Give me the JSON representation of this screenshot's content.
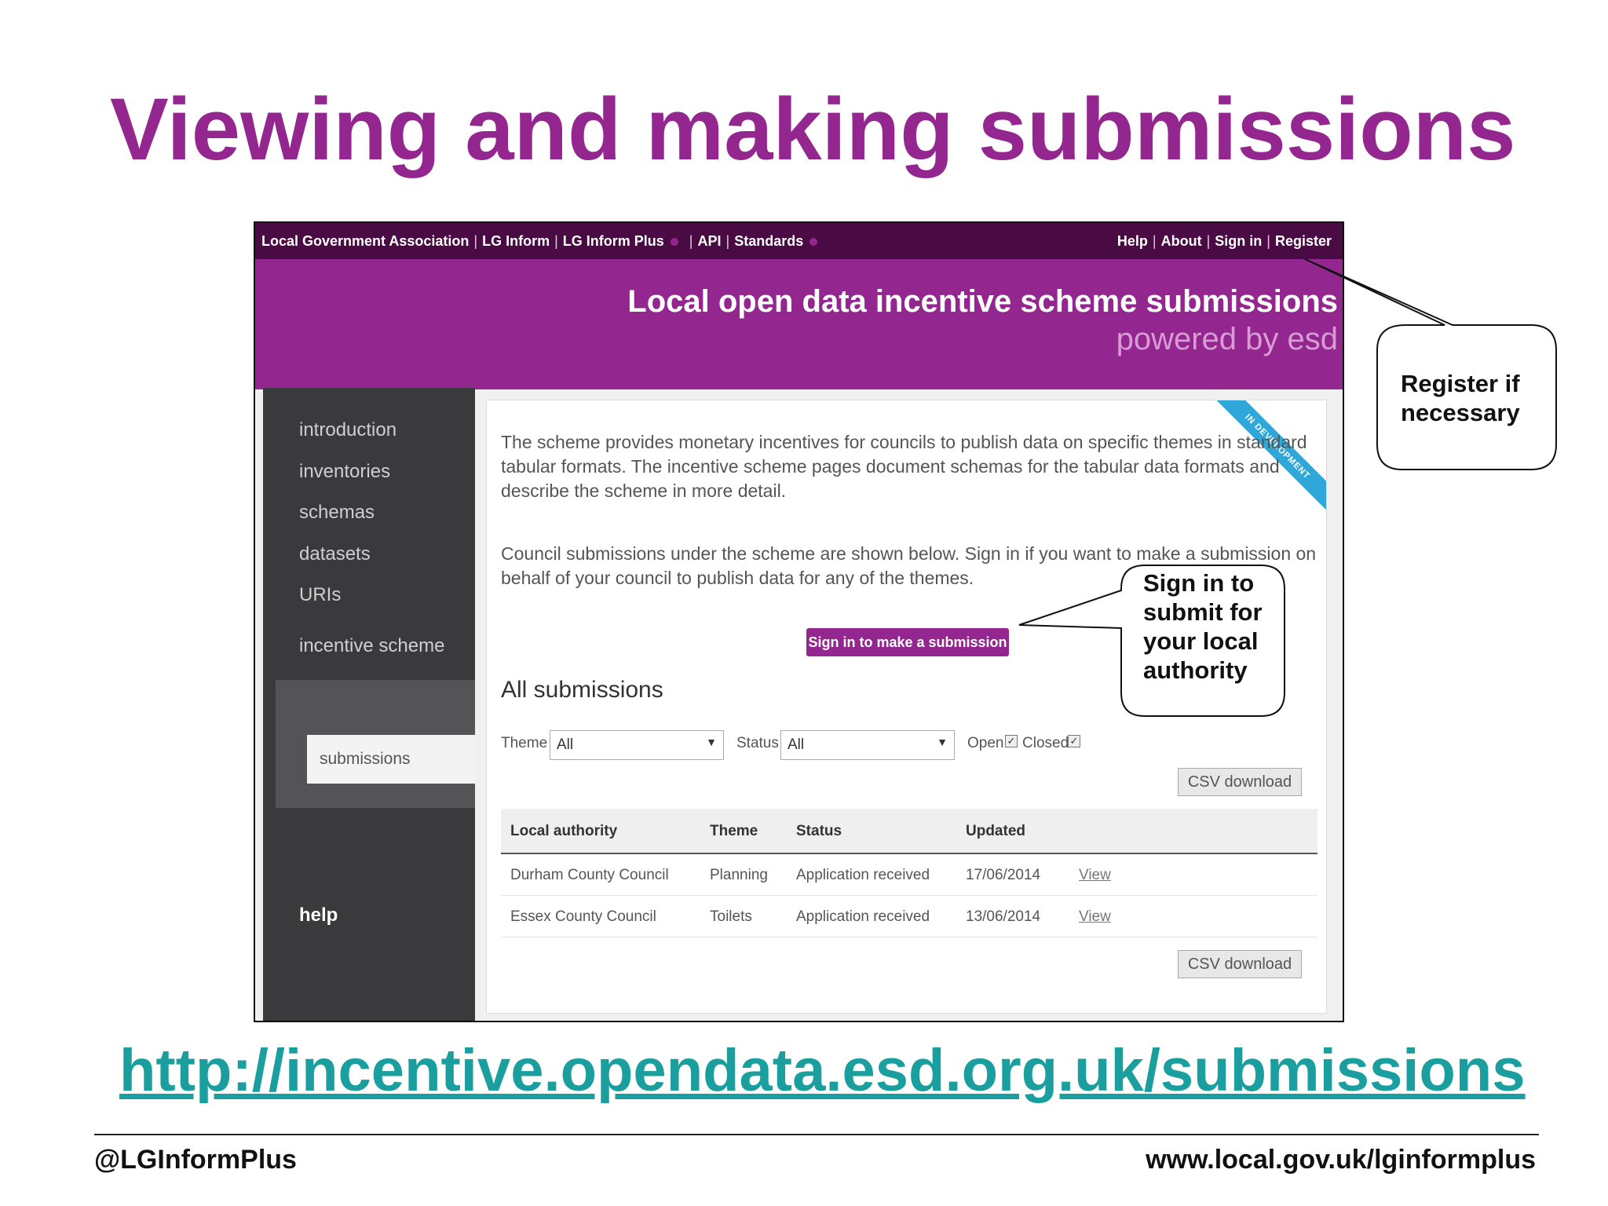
{
  "slide": {
    "title": "Viewing and making submissions",
    "url": "http://incentive.opendata.esd.org.uk/submissions",
    "footer_left": "@LGInformPlus",
    "footer_right": "www.local.gov.uk/lginformplus"
  },
  "topnav": {
    "left": [
      "Local Government Association",
      "LG Inform",
      "LG Inform Plus",
      "API",
      "Standards"
    ],
    "right": [
      "Help",
      "About",
      "Sign in",
      "Register"
    ]
  },
  "banner": {
    "title": "Local open data incentive scheme submissions",
    "subtitle": "powered by esd"
  },
  "sidebar": {
    "items": [
      "introduction",
      "inventories",
      "schemas",
      "datasets",
      "URIs",
      "incentive scheme"
    ],
    "sub_item": "submissions",
    "help": "help"
  },
  "ribbon": "IN DEVELOPMENT",
  "content": {
    "para1": "The scheme provides monetary incentives for councils to publish data on specific themes in standard tabular formats. The incentive scheme pages document schemas for the tabular data formats and describe the scheme in more detail.",
    "para2": "Council submissions under the scheme are shown below. Sign in if you want to make a submission on behalf of your council to publish data for any of the themes.",
    "signin_button": "Sign in to make a submission",
    "section_title": "All submissions",
    "filters": {
      "theme_label": "Theme",
      "theme_value": "All",
      "status_label": "Status",
      "status_value": "All",
      "open_label": "Open",
      "closed_label": "Closed"
    },
    "csv_button": "CSV download",
    "table": {
      "headers": [
        "Local authority",
        "Theme",
        "Status",
        "Updated"
      ],
      "rows": [
        {
          "authority": "Durham County Council",
          "theme": "Planning",
          "status": "Application received",
          "updated": "17/06/2014",
          "link": "View"
        },
        {
          "authority": "Essex County Council",
          "theme": "Toilets",
          "status": "Application received",
          "updated": "13/06/2014",
          "link": "View"
        }
      ]
    }
  },
  "callouts": {
    "register": "Register if necessary",
    "signin": "Sign in to submit for your local authority"
  },
  "colors": {
    "brand_purple": "#93268f",
    "topbar": "#4a0a44",
    "link_teal": "#1a9e9e",
    "ribbon_blue": "#2fa7d8"
  }
}
